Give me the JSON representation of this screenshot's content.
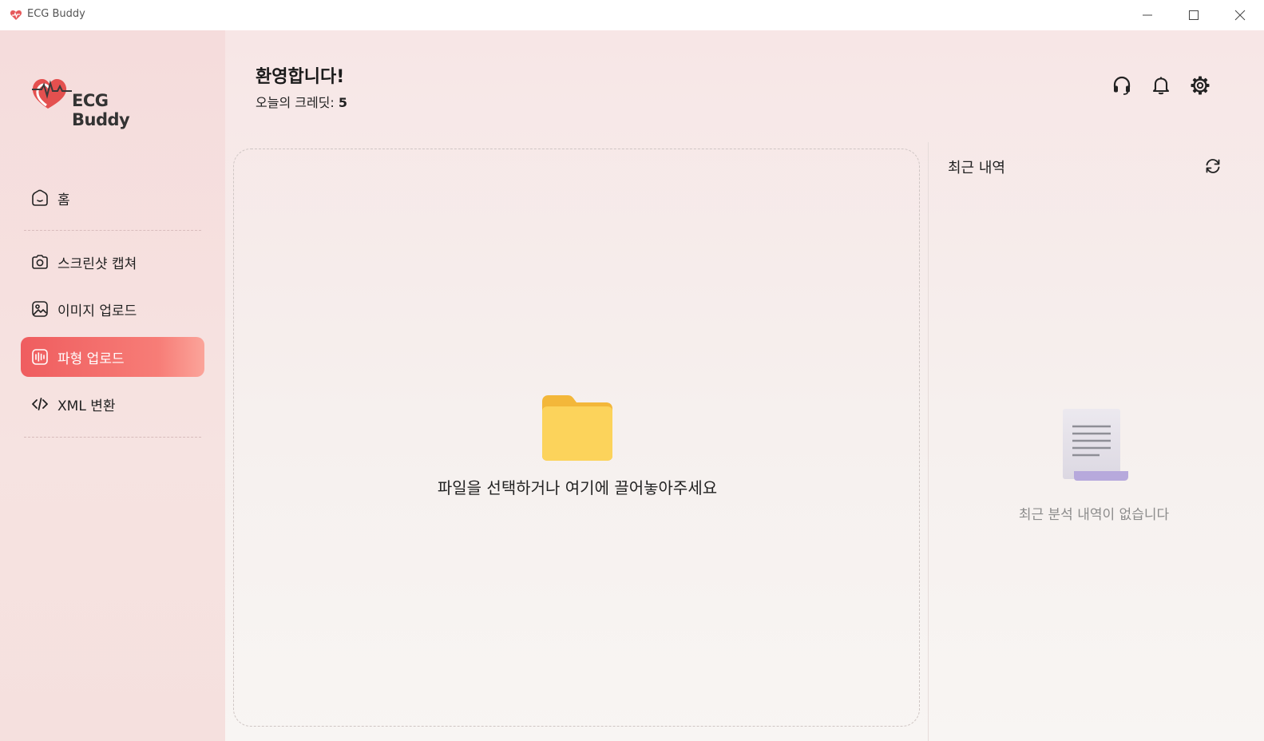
{
  "window": {
    "title": "ECG Buddy",
    "minimize_icon": "minimize-icon",
    "maximize_icon": "maximize-icon",
    "close_icon": "close-icon"
  },
  "brand": {
    "logo_text": "ECG Buddy",
    "accent_color": "#ef5d5f"
  },
  "sidebar": {
    "items": [
      {
        "label": "홈",
        "icon": "home-icon",
        "active": false
      },
      {
        "label": "스크린샷 캡쳐",
        "icon": "camera-icon",
        "active": false
      },
      {
        "label": "이미지 업로드",
        "icon": "image-icon",
        "active": false
      },
      {
        "label": "파형 업로드",
        "icon": "waveform-icon",
        "active": true
      },
      {
        "label": "XML 변환",
        "icon": "code-icon",
        "active": false
      }
    ]
  },
  "header": {
    "welcome": "환영합니다!",
    "credits_label": "오늘의 크레딧:",
    "credits_value": "5",
    "icons": [
      "headset-icon",
      "bell-icon",
      "gear-icon"
    ]
  },
  "dropzone": {
    "text": "파일을 선택하거나 여기에 끌어놓아주세요",
    "icon": "folder-icon"
  },
  "recent": {
    "title": "최근 내역",
    "refresh_icon": "refresh-icon",
    "empty_text": "최근 분석 내역이 없습니다",
    "empty_icon": "document-icon"
  }
}
